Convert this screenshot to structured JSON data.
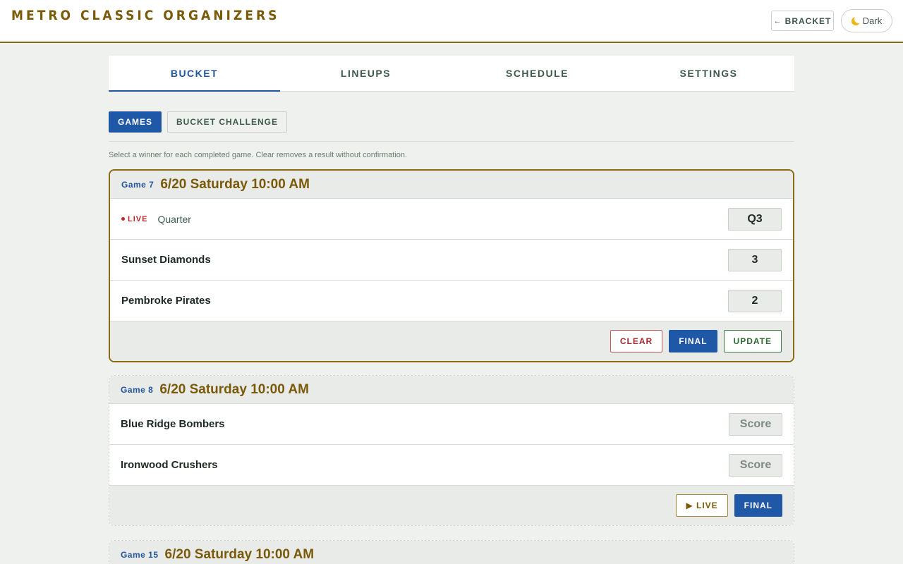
{
  "header": {
    "brand": "METRO CLASSIC ORGANIZERS",
    "bracket_label": "BRACKET",
    "bracket_arrow": "←",
    "dark_label": "Dark"
  },
  "tabs": [
    "BUCKET",
    "LINEUPS",
    "SCHEDULE",
    "SETTINGS"
  ],
  "active_tab": "BUCKET",
  "subtabs": [
    "GAMES",
    "BUCKET CHALLENGE"
  ],
  "active_subtab": "GAMES",
  "hint": "Select a winner for each completed game. Clear removes a result without confirmation.",
  "games": [
    {
      "number": "Game 7",
      "when": "6/20 Saturday 10:00 AM",
      "status": "LIVE",
      "period_label": "Quarter",
      "period_value": "Q3",
      "teams": [
        {
          "name": "Sunset Diamonds",
          "score": "3"
        },
        {
          "name": "Pembroke Pirates",
          "score": "2"
        }
      ],
      "actions": [
        "CLEAR",
        "FINAL",
        "UPDATE"
      ]
    },
    {
      "number": "Game 8",
      "when": "6/20 Saturday 10:00 AM",
      "score_placeholder": "Score",
      "teams": [
        {
          "name": "Blue Ridge Bombers",
          "score": ""
        },
        {
          "name": "Ironwood Crushers",
          "score": ""
        }
      ],
      "actions": [
        "▶ LIVE",
        "FINAL"
      ]
    },
    {
      "number": "Game 15",
      "when": "6/20 Saturday 10:00 AM"
    }
  ],
  "colors": {
    "accent_gold": "#7a5a08",
    "accent_blue": "#2058a8",
    "live_red": "#c0262c",
    "update_green": "#2e6b32"
  }
}
